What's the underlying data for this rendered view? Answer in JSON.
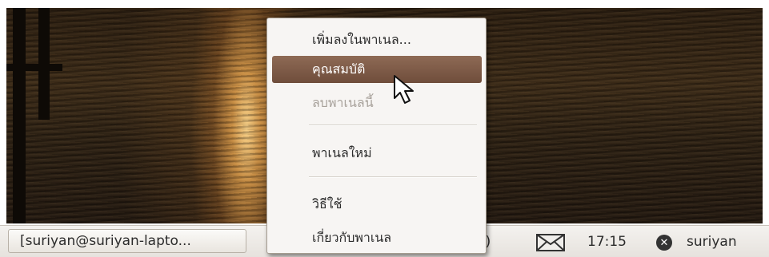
{
  "menu": {
    "items": [
      {
        "label": "เพิ่มลงในพาเนล...",
        "state": "normal"
      },
      {
        "label": "คุณสมบัติ",
        "state": "selected"
      },
      {
        "label": "ลบพาเนลนี้",
        "state": "disabled"
      },
      {
        "label": "พาเนลใหม่",
        "state": "normal"
      },
      {
        "label": "วิธีใช้",
        "state": "normal"
      },
      {
        "label": "เกี่ยวกับพาเนล",
        "state": "normal"
      }
    ]
  },
  "panel": {
    "task_button_label": "[suriyan@suriyan-lapto...",
    "volume_fragment": "))",
    "clock": "17:15",
    "username": "suriyan",
    "icons": [
      "mail-icon",
      "user-status-icon"
    ]
  },
  "colors": {
    "menu_selected": "#7d5a47",
    "panel_bg": "#ece9e5"
  }
}
